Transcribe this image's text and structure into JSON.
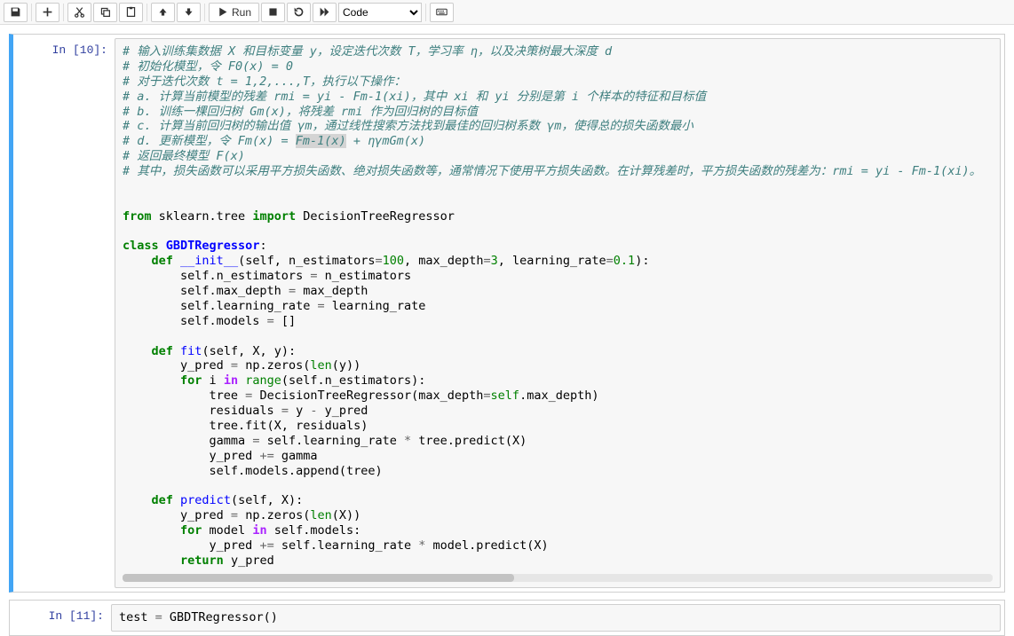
{
  "toolbar": {
    "run_label": "Run",
    "celltype_selected": "Code"
  },
  "cell1": {
    "prompt": "In [10]:",
    "code": {
      "c1": "# 输入训练集数据 X 和目标变量 y，设定迭代次数 T，学习率 η，以及决策树最大深度 d",
      "c2": "# 初始化模型，令 F0(x) = 0",
      "c3": "# 对于迭代次数 t = 1,2,...,T，执行以下操作：",
      "c4": "# a. 计算当前模型的残差 rmi = yi - Fm-1(xi)，其中 xi 和 yi 分别是第 i 个样本的特征和目标值",
      "c5": "# b. 训练一棵回归树 Gm(x)，将残差 rmi 作为回归树的目标值",
      "c6": "# c. 计算当前回归树的输出值 γm，通过线性搜索方法找到最佳的回归树系数 γm，使得总的损失函数最小",
      "c7a": "# d. 更新模型，令 Fm(x) = ",
      "c7b": "Fm-1(x)",
      "c7c": " + ηγmGm(x)",
      "c8": "# 返回最终模型 F(x)",
      "c9": "# 其中，损失函数可以采用平方损失函数、绝对损失函数等，通常情况下使用平方损失函数。在计算残差时，平方损失函数的残差为：rmi = yi - Fm-1(xi)。",
      "l_from": "from",
      "l_sklearn": " sklearn.tree ",
      "l_import": "import",
      "l_dtr": " DecisionTreeRegressor",
      "l_class": "class",
      "l_gbdt": "GBDTRegressor",
      "l_def": "def",
      "l_init": "__init__",
      "l_init_sig_a": "(self, n_estimators",
      "l_eq": "=",
      "l_100": "100",
      "l_init_sig_b": ", max_depth",
      "l_3": "3",
      "l_init_sig_c": ", learning_rate",
      "l_01": "0.1",
      "l_init_sig_d": "):",
      "l_s1a": "        self.n_estimators ",
      "l_s1b": " n_estimators",
      "l_s2a": "        self.max_depth ",
      "l_s2b": " max_depth",
      "l_s3a": "        self.learning_rate ",
      "l_s3b": " learning_rate",
      "l_s4a": "        self.models ",
      "l_s4b": " []",
      "l_fit": "fit",
      "l_fit_sig": "(self, X, y):",
      "l_yp_a": "        y_pred ",
      "l_yp_b": " np.zeros(",
      "l_len": "len",
      "l_yp_c": "(y))",
      "l_for": "for",
      "l_in": "in",
      "l_range": "range",
      "l_for_body": " i ",
      "l_range_sig": "(self.n_estimators):",
      "l_tree_a": "            tree ",
      "l_tree_b": " DecisionTreeRegressor(max_depth",
      "l_tree_c": "self",
      "l_tree_d": ".max_depth)",
      "l_res_a": "            residuals ",
      "l_res_b": " y ",
      "l_minus": "-",
      "l_res_c": " y_pred",
      "l_fitcall": "            tree.fit(X, residuals)",
      "l_gamma_a": "            gamma ",
      "l_gamma_b": " self.learning_rate ",
      "l_star": "*",
      "l_gamma_c": " tree.predict(X)",
      "l_ypg_a": "            y_pred ",
      "l_pluseq": "+=",
      "l_ypg_b": " gamma",
      "l_append": "            self.models.append(tree)",
      "l_predict": "predict",
      "l_pred_sig": "(self, X):",
      "l_yp2_c": "(X))",
      "l_for2_body": " model ",
      "l_for2_tail": " self.models:",
      "l_yp3_a": "            y_pred ",
      "l_yp3_b": " self.learning_rate ",
      "l_yp3_c": " model.predict(X)",
      "l_return": "return",
      "l_ret_b": " y_pred"
    }
  },
  "cell2": {
    "prompt": "In [11]:",
    "line_a": "test ",
    "line_b": "=",
    "line_c": " GBDTRegressor()"
  }
}
